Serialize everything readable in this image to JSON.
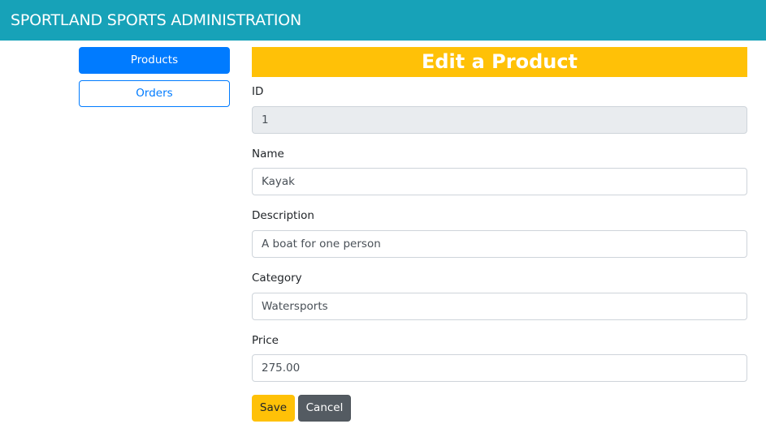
{
  "header": {
    "title": "SPORTLAND SPORTS ADMINISTRATION"
  },
  "sidebar": {
    "items": [
      {
        "label": "Products"
      },
      {
        "label": "Orders"
      }
    ]
  },
  "main": {
    "title": "Edit a Product",
    "fields": {
      "id": {
        "label": "ID",
        "value": "1"
      },
      "name": {
        "label": "Name",
        "value": "Kayak"
      },
      "description": {
        "label": "Description",
        "value": "A boat for one person"
      },
      "category": {
        "label": "Category",
        "value": "Watersports"
      },
      "price": {
        "label": "Price",
        "value": "275.00"
      }
    },
    "buttons": {
      "save": "Save",
      "cancel": "Cancel"
    }
  },
  "colors": {
    "header_bg": "#17a2b8",
    "primary": "#007bff",
    "warning": "#ffc107",
    "secondary": "#545b62",
    "readonly_bg": "#e9ecef"
  }
}
